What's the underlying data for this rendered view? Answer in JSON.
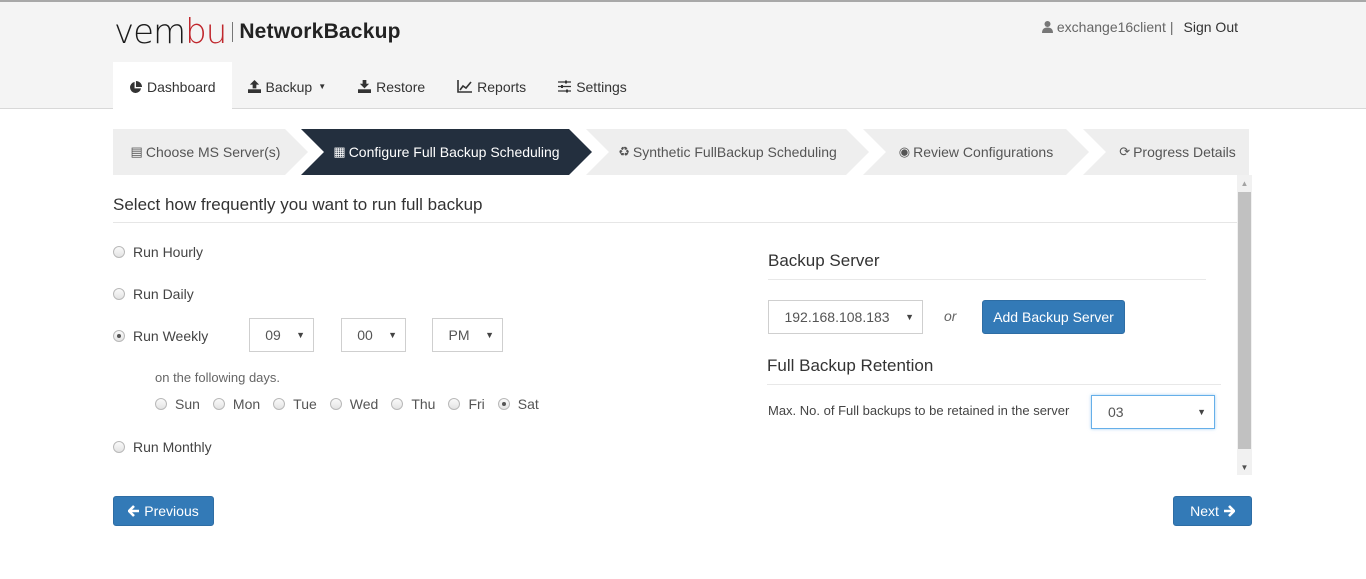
{
  "header": {
    "logo_brand": "vem",
    "logo_brand_accent": "bu",
    "product_name": "NetworkBackup",
    "username": "exchange16client",
    "separator": "|",
    "sign_out": "Sign Out",
    "brand_accent_color": "#c0272d"
  },
  "nav": [
    {
      "label": "Dashboard",
      "icon": "pie-chart-icon",
      "active": true
    },
    {
      "label": "Backup",
      "icon": "upload-icon",
      "has_dropdown": true
    },
    {
      "label": "Restore",
      "icon": "download-icon"
    },
    {
      "label": "Reports",
      "icon": "line-chart-icon"
    },
    {
      "label": "Settings",
      "icon": "sliders-icon"
    }
  ],
  "wizard": {
    "active_color": "#232f3e",
    "steps": [
      {
        "label": "Choose MS Server(s)",
        "icon": "file-icon"
      },
      {
        "label": "Configure Full Backup Scheduling",
        "icon": "calendar-icon",
        "active": true
      },
      {
        "label": "Synthetic FullBackup Scheduling",
        "icon": "recycle-icon"
      },
      {
        "label": "Review Configurations",
        "icon": "eye-icon"
      },
      {
        "label": "Progress Details",
        "icon": "refresh-icon"
      }
    ]
  },
  "schedule": {
    "heading": "Select how frequently you want to run full backup",
    "options": {
      "hourly": "Run Hourly",
      "daily": "Run Daily",
      "weekly": "Run Weekly",
      "monthly": "Run Monthly"
    },
    "selected": "weekly",
    "hour": "09",
    "minute": "00",
    "ampm": "PM",
    "days_label": "on the following days.",
    "days": [
      "Sun",
      "Mon",
      "Tue",
      "Wed",
      "Thu",
      "Fri",
      "Sat"
    ],
    "selected_day": "Sat"
  },
  "backup_server": {
    "heading": "Backup Server",
    "selected": "192.168.108.183",
    "or_label": "or",
    "add_button": "Add Backup Server"
  },
  "retention": {
    "heading": "Full Backup Retention",
    "label": "Max. No. of Full backups to be retained in the server",
    "value": "03"
  },
  "footer": {
    "previous": "Previous",
    "next": "Next"
  },
  "primary_color": "#337ab7"
}
